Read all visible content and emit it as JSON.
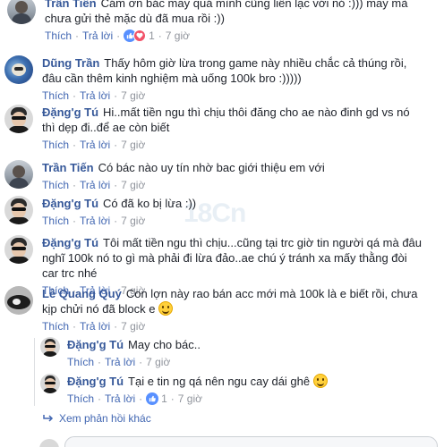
{
  "comments": [
    {
      "name": "Trần Tiến",
      "text": "Cám ơn bác may quá mình cũng liên lạc với nó :))) may mà chưa gửi thẻ mặc dù đã mua rồi :))",
      "actions": {
        "like": "Thích",
        "reply": "Trả lời",
        "reactions": "1",
        "time": "7 giờ"
      }
    },
    {
      "name": "Dũng Trần",
      "text": "Thấy hôm giờ lừa trong game này nhiều chắc cả thúng rồi, đâu cần thêm kinh nghiệm mà uống 100k bro :)))))",
      "actions": {
        "like": "Thích",
        "reply": "Trả lời",
        "time": "7 giờ"
      }
    },
    {
      "name": "Đặng'g Tú",
      "text": "Hi..mất tiền ngu thì chịu thôi đăng cho ae nào đinh gd vs nó thì dẹp đi..để ae còn biết",
      "actions": {
        "like": "Thích",
        "reply": "Trả lời",
        "time": "7 giờ"
      }
    },
    {
      "name": "Trần Tiến",
      "text": "Có bác nào uy tín nhờ bac giới thiệu em với",
      "actions": {
        "like": "Thích",
        "reply": "Trả lời",
        "time": "7 giờ"
      }
    },
    {
      "name": "Đặng'g Tú",
      "text": "Có đã ko bị lừa :))",
      "actions": {
        "like": "Thích",
        "reply": "Trả lời",
        "time": "7 giờ"
      }
    },
    {
      "name": "Đặng'g Tú",
      "text": "Tôi mất tiền ngu thì chịu...cũng tại trc giờ tin người qá mà đâu nghĩ 100k nó to gì mà phải đi lừa đảo..ae chú ý tránh xa mấy thằng đòi car trc nhé",
      "actions": {
        "like": "Thích",
        "reply": "Trả lời",
        "time": "7 giờ"
      }
    },
    {
      "name": "Lê Quang Quý",
      "text": "Con lợn này rao bán acc mới mà 100k là e biết rồi, chưa kịp chửi nó đã block e",
      "actions": {
        "like": "Thích",
        "reply": "Trả lời",
        "time": "7 giờ"
      }
    }
  ],
  "replies": [
    {
      "name": "Đặng'g Tú",
      "text": "May cho bác..",
      "actions": {
        "like": "Thích",
        "reply": "Trả lời",
        "time": "7 giờ"
      }
    },
    {
      "name": "Đặng'g Tú",
      "text": "Tại e tin ng qá nên ngu cay dái ghê",
      "actions": {
        "like": "Thích",
        "reply": "Trả lời",
        "reactions": "1",
        "time": "7 giờ"
      }
    }
  ],
  "more_replies": "Xem phản hồi khác",
  "watermark": "18Cn",
  "colors": {
    "link": "#365899",
    "action": "#4267b2",
    "meta": "#90949c",
    "like": "#5890ff",
    "love": "#f25268"
  },
  "icons": [
    "like-icon",
    "love-icon",
    "smile-emoji",
    "reply-arrow-icon"
  ]
}
